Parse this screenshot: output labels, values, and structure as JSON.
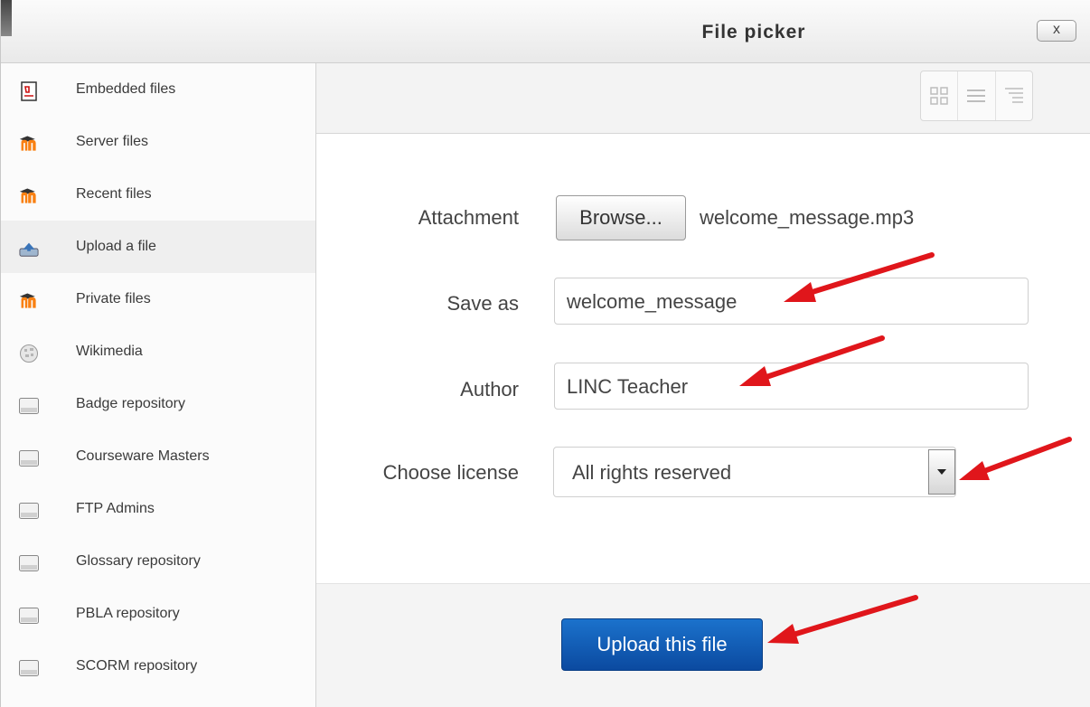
{
  "window": {
    "title": "File picker",
    "close_label": "x"
  },
  "sidebar": {
    "items": [
      {
        "label": "Embedded files",
        "icon": "pdf-document-icon",
        "active": false
      },
      {
        "label": "Server files",
        "icon": "moodle-logo-icon",
        "active": false
      },
      {
        "label": "Recent files",
        "icon": "moodle-logo-icon",
        "active": false
      },
      {
        "label": "Upload a file",
        "icon": "upload-icon",
        "active": true
      },
      {
        "label": "Private files",
        "icon": "moodle-logo-icon",
        "active": false
      },
      {
        "label": "Wikimedia",
        "icon": "wikimedia-globe-icon",
        "active": false
      },
      {
        "label": "Badge repository",
        "icon": "repository-icon",
        "active": false
      },
      {
        "label": "Courseware Masters",
        "icon": "repository-icon",
        "active": false
      },
      {
        "label": "FTP Admins",
        "icon": "repository-icon",
        "active": false
      },
      {
        "label": "Glossary repository",
        "icon": "repository-icon",
        "active": false
      },
      {
        "label": "PBLA repository",
        "icon": "repository-icon",
        "active": false
      },
      {
        "label": "SCORM repository",
        "icon": "repository-icon",
        "active": false
      }
    ]
  },
  "toolbar": {
    "views": [
      "grid-view-icon",
      "list-view-icon",
      "tree-view-icon"
    ]
  },
  "form": {
    "attachment_label": "Attachment",
    "browse_label": "Browse...",
    "filename": "welcome_message.mp3",
    "saveas_label": "Save as",
    "saveas_value": "welcome_message",
    "author_label": "Author",
    "author_value": "LINC Teacher",
    "license_label": "Choose license",
    "license_value": "All rights reserved"
  },
  "footer": {
    "upload_label": "Upload this file"
  },
  "colors": {
    "accent": "#0b4aa0",
    "annotation_arrow": "#e0161b",
    "moodle_orange": "#f98012"
  }
}
